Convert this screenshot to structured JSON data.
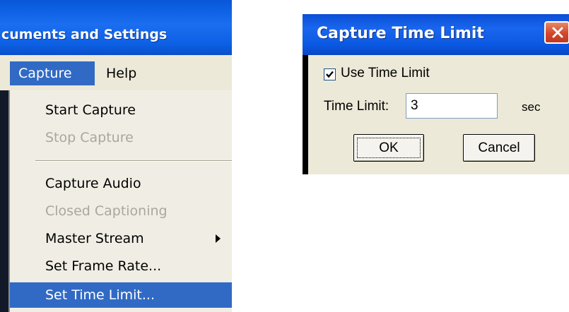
{
  "window": {
    "title_fragment": "cuments and Settings"
  },
  "menubar": {
    "items": [
      {
        "label": "Capture"
      },
      {
        "label": "Help"
      }
    ]
  },
  "capture_menu": {
    "items": [
      {
        "label": "Start Capture",
        "enabled": true
      },
      {
        "label": "Stop Capture",
        "enabled": false
      },
      {
        "label": "Capture Audio",
        "enabled": true
      },
      {
        "label": "Closed Captioning",
        "enabled": false
      },
      {
        "label": "Master Stream",
        "enabled": true,
        "submenu": true
      },
      {
        "label": "Set Frame Rate...",
        "enabled": true
      },
      {
        "label": "Set Time Limit...",
        "enabled": true,
        "selected": true
      }
    ]
  },
  "dialog": {
    "title": "Capture Time Limit",
    "use_time_limit_label": "Use Time Limit",
    "use_time_limit_checked": true,
    "time_limit_label": "Time Limit:",
    "time_limit_value": "3",
    "unit_label": "sec",
    "ok_label": "OK",
    "cancel_label": "Cancel"
  },
  "colors": {
    "titlebar_blue": "#0b5ee0",
    "menu_highlight": "#316ac5",
    "dialog_face": "#ece9d8",
    "close_red": "#d4462a"
  },
  "icons": [
    "close-icon",
    "checkmark-icon",
    "submenu-arrow-icon"
  ]
}
